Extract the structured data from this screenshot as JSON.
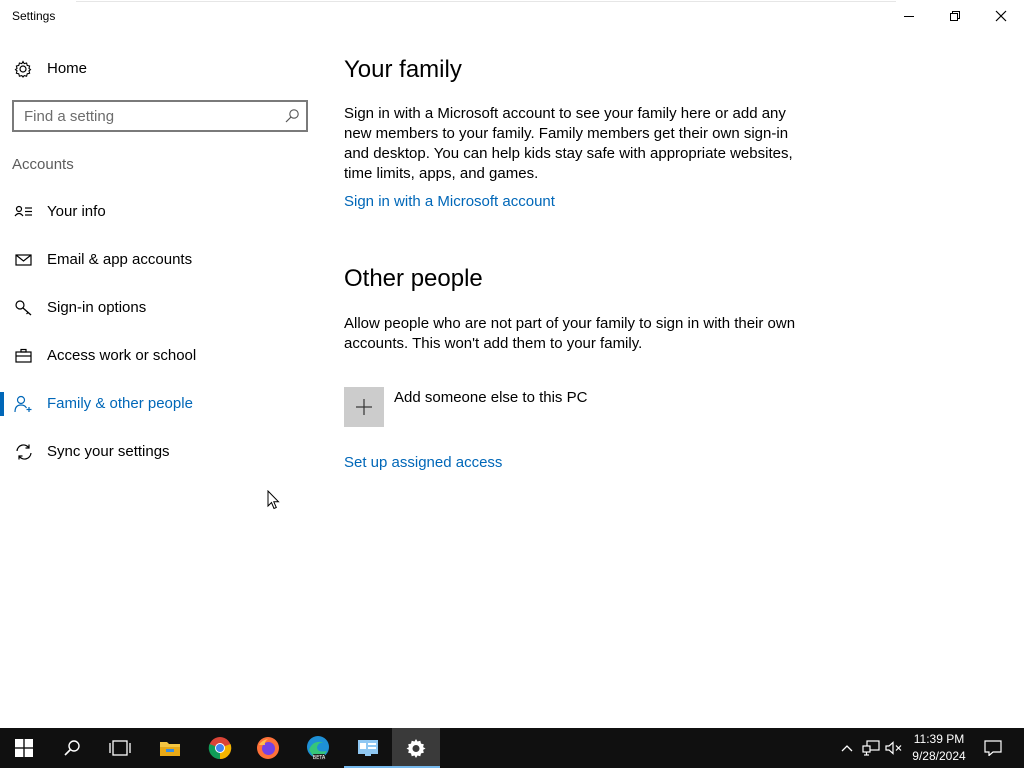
{
  "window": {
    "title": "Settings"
  },
  "sidebar": {
    "home_label": "Home",
    "search_placeholder": "Find a setting",
    "section_label": "Accounts",
    "items": [
      {
        "label": "Your info",
        "icon": "contact-card-icon"
      },
      {
        "label": "Email & app accounts",
        "icon": "mail-icon"
      },
      {
        "label": "Sign-in options",
        "icon": "key-icon"
      },
      {
        "label": "Access work or school",
        "icon": "briefcase-icon"
      },
      {
        "label": "Family & other people",
        "icon": "add-person-icon",
        "active": true
      },
      {
        "label": "Sync your settings",
        "icon": "sync-icon"
      }
    ]
  },
  "main": {
    "family": {
      "heading": "Your family",
      "description": "Sign in with a Microsoft account to see your family here or add any new members to your family. Family members get their own sign-in and desktop. You can help kids stay safe with appropriate websites, time limits, apps, and games.",
      "link": "Sign in with a Microsoft account"
    },
    "other": {
      "heading": "Other people",
      "description": "Allow people who are not part of your family to sign in with their own accounts. This won't add them to your family.",
      "add_label": "Add someone else to this PC",
      "link": "Set up assigned access"
    }
  },
  "taskbar": {
    "apps": [
      "start-icon",
      "search-icon",
      "task-view-icon",
      "file-explorer-icon",
      "chrome-icon",
      "firefox-icon",
      "edge-beta-icon",
      "remote-desktop-icon",
      "settings-icon"
    ],
    "time": "11:39 PM",
    "date": "9/28/2024"
  },
  "colors": {
    "accent": "#0067b8",
    "taskbar": "#101010",
    "add_tile": "#cccccc"
  }
}
